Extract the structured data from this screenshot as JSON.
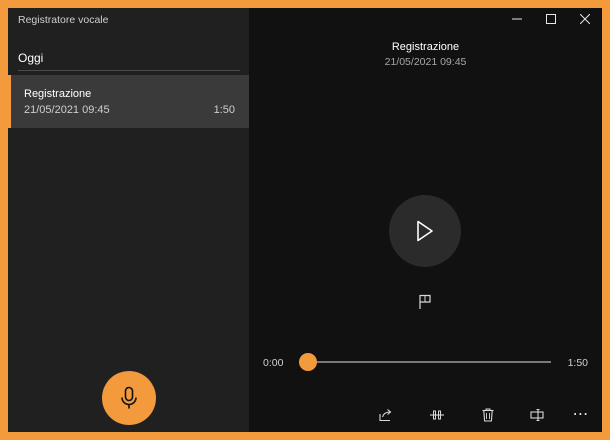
{
  "app": {
    "title": "Registratore vocale"
  },
  "list": {
    "group_header": "Oggi",
    "items": [
      {
        "name": "Registrazione",
        "date": "21/05/2021 09:45",
        "duration": "1:50",
        "selected": true
      }
    ]
  },
  "player": {
    "title": "Registrazione",
    "date": "21/05/2021 09:45",
    "current_time": "0:00",
    "total_time": "1:50",
    "progress": 0
  },
  "icons": {
    "record": "microphone-icon",
    "play": "play-icon",
    "marker": "flag-icon",
    "share": "share-icon",
    "trim": "trim-icon",
    "delete": "trash-icon",
    "rename": "rename-icon",
    "more": "more-icon"
  },
  "colors": {
    "accent": "#f39a3c",
    "left_pane_bg": "#202020",
    "right_pane_bg": "#111111",
    "selected_item_bg": "#3a3a3a"
  }
}
